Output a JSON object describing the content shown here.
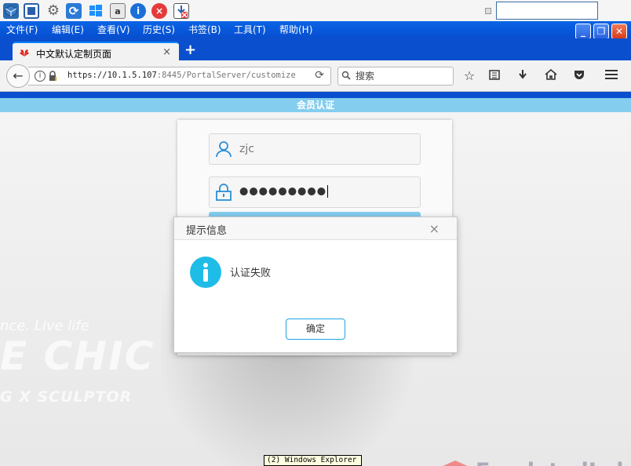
{
  "toolbar": {
    "icons": [
      "cube-icon",
      "fullscreen-icon",
      "gear-icon",
      "refresh-icon",
      "windows-icon",
      "document-icon",
      "info-icon",
      "close-icon",
      "download-error-icon"
    ]
  },
  "menubar": {
    "items": [
      "文件(F)",
      "编辑(E)",
      "查看(V)",
      "历史(S)",
      "书签(B)",
      "工具(T)",
      "帮助(H)"
    ]
  },
  "tab": {
    "title": "中文默认定制页面",
    "close": "×",
    "new_tab": "+"
  },
  "navbar": {
    "url_host": "https://10.1.5.107",
    "url_rest": ":8445/PortalServer/customize",
    "search_placeholder": "搜索"
  },
  "page": {
    "header_title": "会员认证",
    "username_value": "zjc",
    "password_value": "●●●●●●●●●",
    "background_slogan": "nce. Live life",
    "background_big": "E CHIC",
    "background_sub": "G X SCULPTOR"
  },
  "dialog": {
    "title": "提示信息",
    "close": "×",
    "message": "认证失败",
    "ok_label": "确定"
  },
  "watermark": {
    "text": "EmulatedLab"
  },
  "tooltip": {
    "text": "(2) Windows Explorer"
  },
  "colors": {
    "accent": "#84cdee",
    "info": "#1fbce8",
    "window_blue": "#0a4fce"
  }
}
